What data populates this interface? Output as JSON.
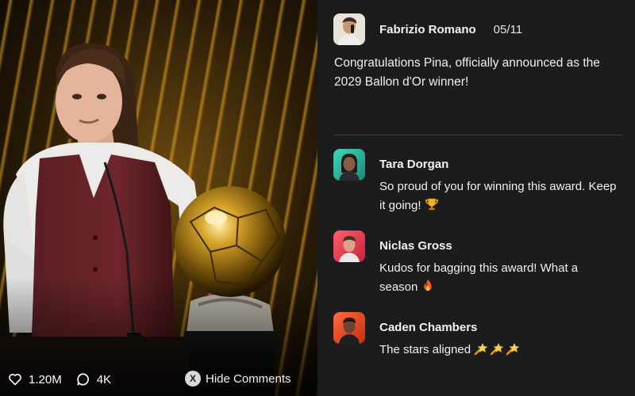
{
  "post": {
    "author": "Fabrizio Romano",
    "date": "05/11",
    "text": "Congratulations Pina, officially announced as the 2029 Ballon d'Or winner!"
  },
  "stats": {
    "likes": "1.20M",
    "comments": "4K"
  },
  "hide_comments": {
    "button_glyph": "X",
    "label": "Hide Comments"
  },
  "comments": [
    {
      "name": "Tara Dorgan",
      "text": "So proud of you for winning this award. Keep it going!",
      "emoji": "trophy-icon"
    },
    {
      "name": "Niclas Gross",
      "text": "Kudos for bagging this award! What a season",
      "emoji": "fire-icon"
    },
    {
      "name": "Caden Chambers",
      "text": "The stars aligned",
      "emoji": "shooting-star-icon"
    }
  ],
  "colors": {
    "panel_bg": "#1c1c1c",
    "accent_gold": "#c99a2e",
    "text": "#f2f2f2"
  }
}
